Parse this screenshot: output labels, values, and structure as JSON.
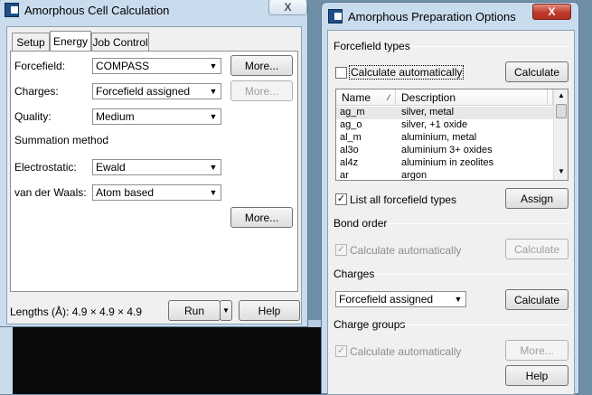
{
  "calc_window": {
    "title": "Amorphous Cell Calculation",
    "close": "X",
    "tabs": [
      "Setup",
      "Energy",
      "Job Control"
    ],
    "forcefield_label": "Forcefield:",
    "forcefield_value": "COMPASS",
    "charges_label": "Charges:",
    "charges_value": "Forcefield assigned",
    "quality_label": "Quality:",
    "quality_value": "Medium",
    "more1": "More...",
    "more2": "More...",
    "summation_title": "Summation method",
    "electrostatic_label": "Electrostatic:",
    "electrostatic_value": "Ewald",
    "vdw_label": "van der Waals:",
    "vdw_value": "Atom based",
    "more3": "More...",
    "lengths": "Lengths (Å): 4.9 × 4.9 × 4.9",
    "run": "Run",
    "help": "Help"
  },
  "prep_window": {
    "title": "Amorphous Preparation Options",
    "close": "X",
    "ff_types_title": "Forcefield types",
    "calc_auto_label": "Calculate automatically",
    "calc_button": "Calculate",
    "col_name": "Name",
    "col_desc": "Description",
    "rows": [
      {
        "name": "ag_m",
        "desc": "silver, metal"
      },
      {
        "name": "ag_o",
        "desc": "silver, +1 oxide"
      },
      {
        "name": "al_m",
        "desc": "aluminium, metal"
      },
      {
        "name": "al3o",
        "desc": "aluminium 3+ oxides"
      },
      {
        "name": "al4z",
        "desc": "aluminium in zeolites"
      },
      {
        "name": "ar",
        "desc": "argon"
      }
    ],
    "list_all_label": "List all forcefield types",
    "assign_button": "Assign",
    "bond_order_title": "Bond order",
    "bond_calc_label": "Calculate automatically",
    "bond_calc_button": "Calculate",
    "charges_title": "Charges",
    "charges_value": "Forcefield assigned",
    "charges_calc_button": "Calculate",
    "charge_groups_title": "Charge groups",
    "cg_calc_label": "Calculate automatically",
    "cg_more_button": "More...",
    "help": "Help"
  }
}
